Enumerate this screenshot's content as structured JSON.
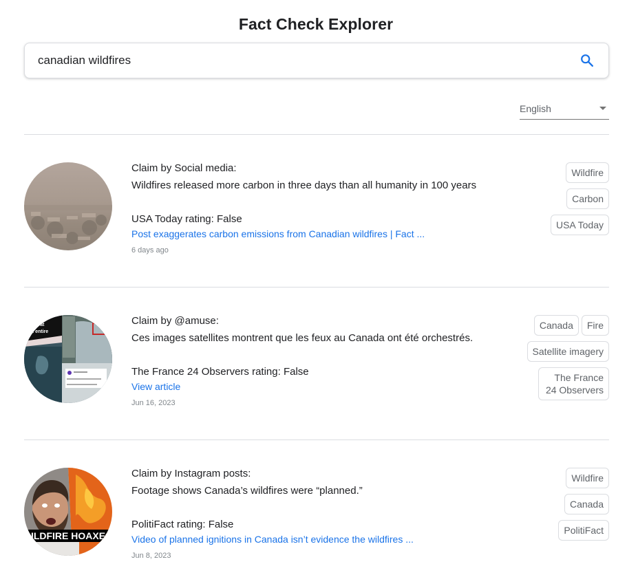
{
  "header": {
    "title": "Fact Check Explorer"
  },
  "search": {
    "value": "canadian wildfires",
    "icon": "search-icon",
    "accent_color": "#1a73e8"
  },
  "language": {
    "selected": "English"
  },
  "results": [
    {
      "thumbnail": "hazy smoke-covered city skyline",
      "claim_label": "Claim by ",
      "claimant": "Social media",
      "claim_suffix": ":",
      "claim_text": "Wildfires released more carbon in three days than all humanity in 100 years",
      "publisher": "USA Today",
      "rating_label": " rating: ",
      "rating": "False",
      "article_title": "Post exaggerates carbon emissions from Canadian wildfires | Fact ...",
      "date": "6 days ago",
      "tags": [
        "Wildfire",
        "Carbon",
        "USA Today"
      ]
    },
    {
      "thumbnail": "collage of satellite images and social post",
      "claim_label": "Claim by ",
      "claimant": "@amuse",
      "claim_suffix": ":",
      "claim_text": "Ces images satellites montrent que les feux au Canada ont été orchestrés.",
      "publisher": "The France 24 Observers",
      "rating_label": " rating: ",
      "rating": "False",
      "article_title": "View article",
      "date": "Jun 16, 2023",
      "tags": [
        "Canada",
        "Fire",
        "Satellite imagery",
        "The France 24 Observers"
      ]
    },
    {
      "thumbnail": "man in front of flames with caption WILDFIRE HOAXES",
      "thumbnail_caption": "ILDFIRE HOAXE",
      "claim_label": "Claim by ",
      "claimant": "Instagram posts",
      "claim_suffix": ":",
      "claim_text": "Footage shows Canada’s wildfires were “planned.”",
      "publisher": "PolitiFact",
      "rating_label": " rating: ",
      "rating": "False",
      "article_title": "Video of planned ignitions in Canada isn’t evidence the wildfires ...",
      "date": "Jun 8, 2023",
      "tags": [
        "Wildfire",
        "Canada",
        "PolitiFact"
      ]
    }
  ]
}
